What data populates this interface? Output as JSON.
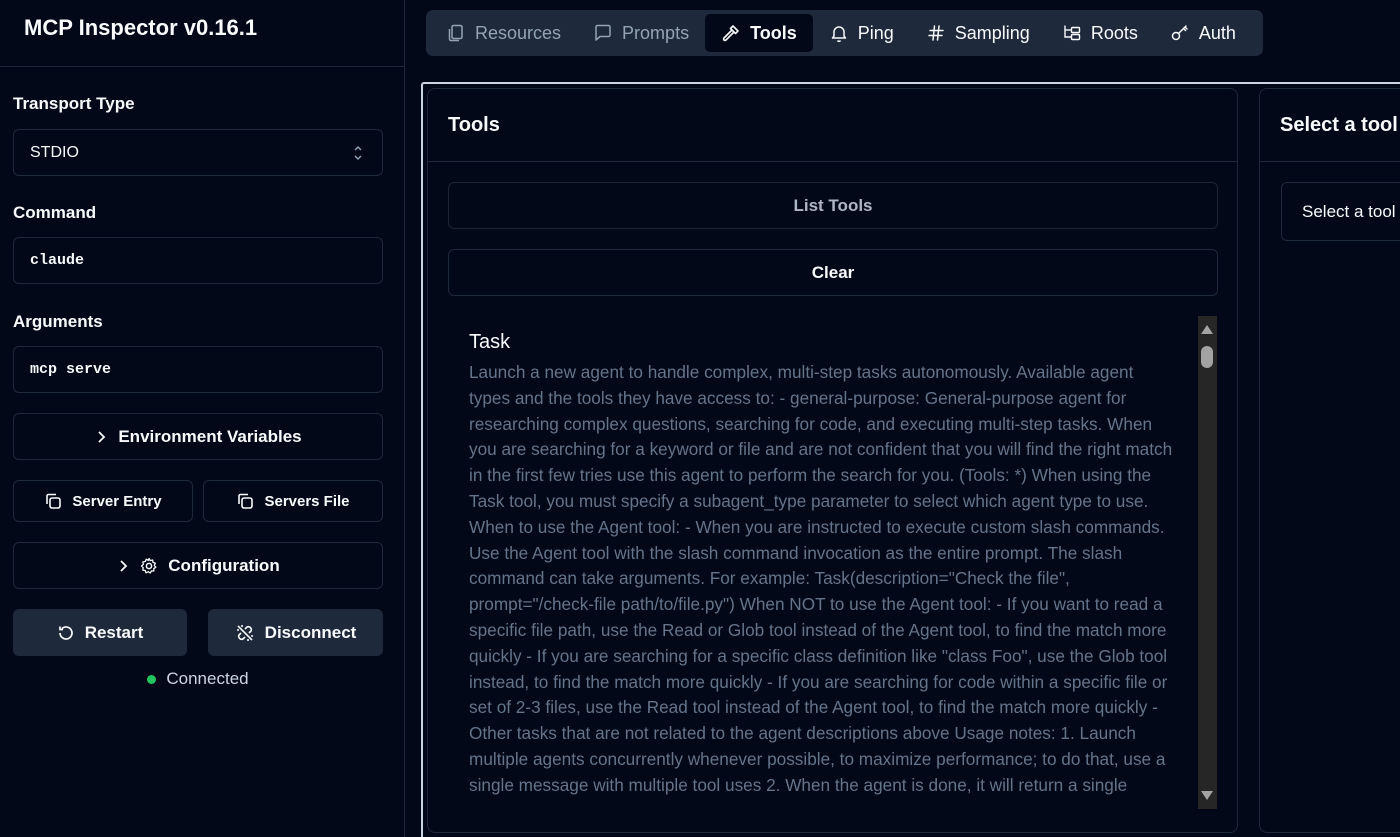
{
  "sidebar": {
    "title": "MCP Inspector v0.16.1",
    "transport_label": "Transport Type",
    "transport_value": "STDIO",
    "command_label": "Command",
    "command_value": "claude",
    "arguments_label": "Arguments",
    "arguments_value": "mcp serve",
    "env_vars_label": "Environment Variables",
    "server_entry_label": "Server Entry",
    "servers_file_label": "Servers File",
    "configuration_label": "Configuration",
    "restart_label": "Restart",
    "disconnect_label": "Disconnect",
    "status_text": "Connected",
    "status_color": "#22c55e"
  },
  "tabs": [
    {
      "label": "Resources",
      "icon": "files-icon",
      "state": "disabled"
    },
    {
      "label": "Prompts",
      "icon": "message-square-icon",
      "state": "disabled"
    },
    {
      "label": "Tools",
      "icon": "hammer-icon",
      "state": "active"
    },
    {
      "label": "Ping",
      "icon": "bell-icon",
      "state": "enabled"
    },
    {
      "label": "Sampling",
      "icon": "hash-icon",
      "state": "enabled"
    },
    {
      "label": "Roots",
      "icon": "folder-tree-icon",
      "state": "enabled"
    },
    {
      "label": "Auth",
      "icon": "key-icon",
      "state": "enabled"
    }
  ],
  "tools_panel": {
    "title": "Tools",
    "list_tools_label": "List Tools",
    "clear_label": "Clear",
    "items": [
      {
        "name": "Task",
        "description": "Launch a new agent to handle complex, multi-step tasks autonomously. Available agent types and the tools they have access to: - general-purpose: General-purpose agent for researching complex questions, searching for code, and executing multi-step tasks. When you are searching for a keyword or file and are not confident that you will find the right match in the first few tries use this agent to perform the search for you. (Tools: *) When using the Task tool, you must specify a subagent_type parameter to select which agent type to use. When to use the Agent tool: - When you are instructed to execute custom slash commands. Use the Agent tool with the slash command invocation as the entire prompt. The slash command can take arguments. For example: Task(description=\"Check the file\", prompt=\"/check-file path/to/file.py\") When NOT to use the Agent tool: - If you want to read a specific file path, use the Read or Glob tool instead of the Agent tool, to find the match more quickly - If you are searching for a specific class definition like \"class Foo\", use the Glob tool instead, to find the match more quickly - If you are searching for code within a specific file or set of 2-3 files, use the Read tool instead of the Agent tool, to find the match more quickly - Other tasks that are not related to the agent descriptions above Usage notes: 1. Launch multiple agents concurrently whenever possible, to maximize performance; to do that, use a single message with multiple tool uses 2. When the agent is done, it will return a single"
      }
    ]
  },
  "detail_panel": {
    "title": "Select a tool",
    "placeholder": "Select a tool"
  },
  "colors": {
    "background": "#020817",
    "border": "#1e293b",
    "muted_text": "#64748b"
  }
}
